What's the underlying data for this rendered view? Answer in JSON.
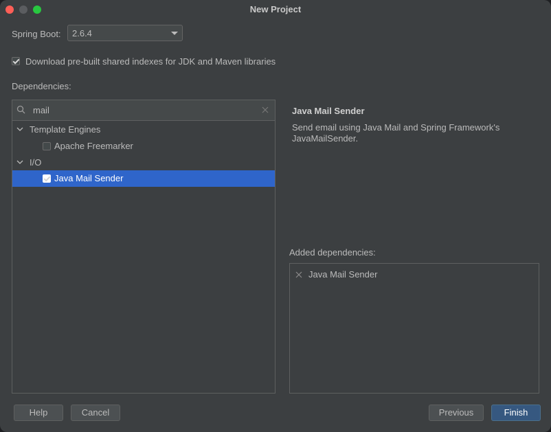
{
  "window": {
    "title": "New Project"
  },
  "spring_boot": {
    "label": "Spring Boot:",
    "selected": "2.6.4"
  },
  "download_indexes": {
    "checked": true,
    "label": "Download pre-built shared indexes for JDK and Maven libraries"
  },
  "dependencies": {
    "label": "Dependencies:",
    "search": {
      "value": "mail"
    },
    "tree": {
      "group1": {
        "label": "Template Engines",
        "item": {
          "label": "Apache Freemarker",
          "checked": false
        }
      },
      "group2": {
        "label": "I/O",
        "item": {
          "label": "Java Mail Sender",
          "checked": true
        }
      }
    }
  },
  "detail": {
    "title": "Java Mail Sender",
    "description": "Send email using Java Mail and Spring Framework's JavaMailSender."
  },
  "added": {
    "label": "Added dependencies:",
    "items": [
      "Java Mail Sender"
    ]
  },
  "buttons": {
    "help": "Help",
    "cancel": "Cancel",
    "previous": "Previous",
    "finish": "Finish"
  },
  "colors": {
    "background": "#3c3f41",
    "selection": "#2f65ca",
    "primary_button": "#365880"
  }
}
